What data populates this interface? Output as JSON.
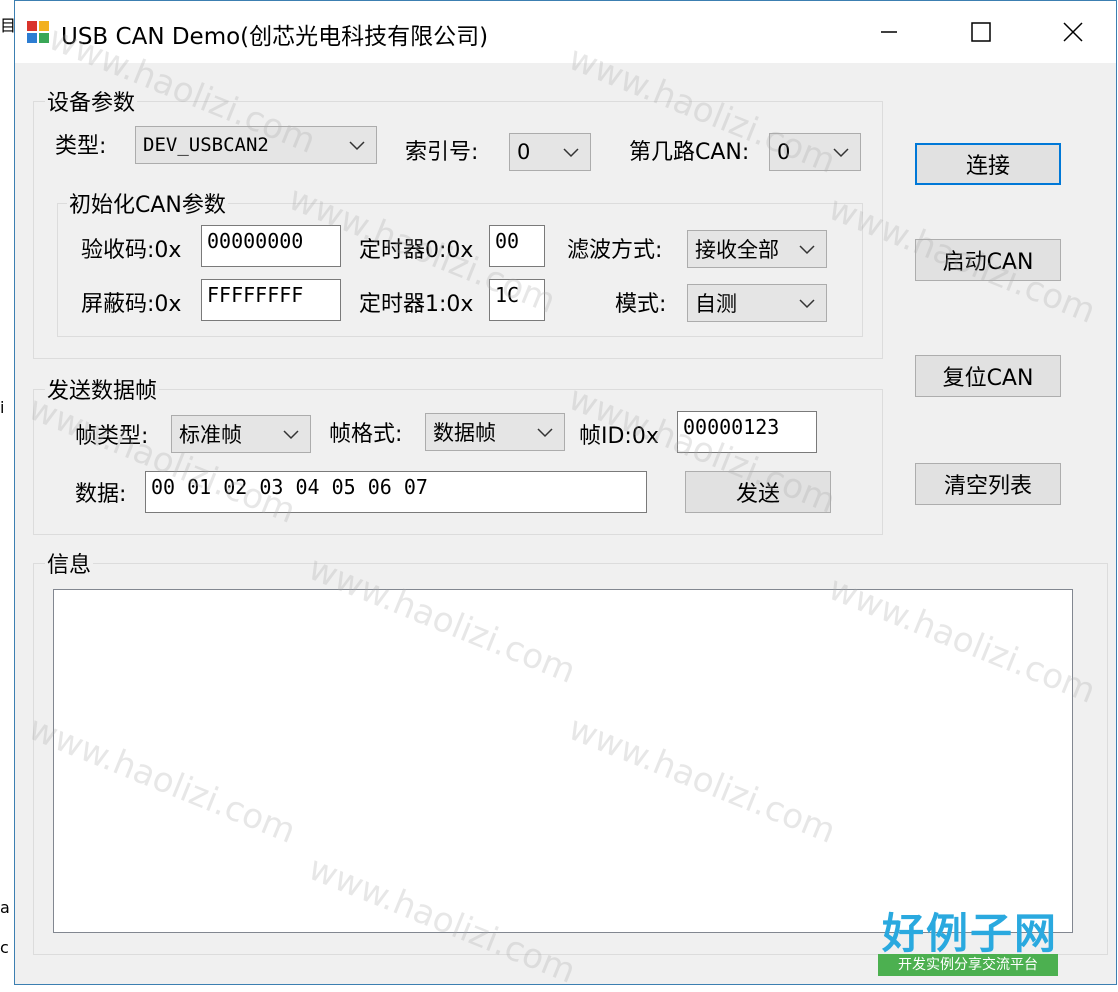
{
  "window": {
    "title": "USB CAN Demo(创芯光电科技有限公司)",
    "controls": {
      "minimize": "minimize",
      "maximize": "maximize",
      "close": "close"
    }
  },
  "device_group": {
    "label": "设备参数",
    "type_label": "类型:",
    "type_value": "DEV_USBCAN2",
    "index_label": "索引号:",
    "index_value": "0",
    "channel_label": "第几路CAN:",
    "channel_value": "0"
  },
  "init_group": {
    "label": "初始化CAN参数",
    "acc_code_label": "验收码:0x",
    "acc_code_value": "00000000",
    "mask_label": "屏蔽码:0x",
    "mask_value": "FFFFFFFF",
    "timer0_label": "定时器0:0x",
    "timer0_value": "00",
    "timer1_label": "定时器1:0x",
    "timer1_value": "1C",
    "filter_label": "滤波方式:",
    "filter_value": "接收全部",
    "mode_label": "模式:",
    "mode_value": "自测"
  },
  "send_group": {
    "label": "发送数据帧",
    "frame_type_label": "帧类型:",
    "frame_type_value": "标准帧",
    "frame_format_label": "帧格式:",
    "frame_format_value": "数据帧",
    "frame_id_label": "帧ID:0x",
    "frame_id_value": "00000123",
    "data_label": "数据:",
    "data_value": "00 01 02 03 04 05 06 07",
    "send_button": "发送"
  },
  "info_group": {
    "label": "信息"
  },
  "side_buttons": {
    "connect": "连接",
    "start_can": "启动CAN",
    "reset_can": "复位CAN",
    "clear_list": "清空列表"
  },
  "watermark": {
    "text": "www.haolizi.com"
  },
  "logo": {
    "main": "好例子网",
    "sub": "开发实例分享交流平台"
  },
  "background_fragments": [
    "目",
    "i",
    "a",
    "c"
  ],
  "colors": {
    "accent": "#0078d7",
    "logo_blue": "#2aa9df",
    "logo_green": "#4cb050"
  }
}
